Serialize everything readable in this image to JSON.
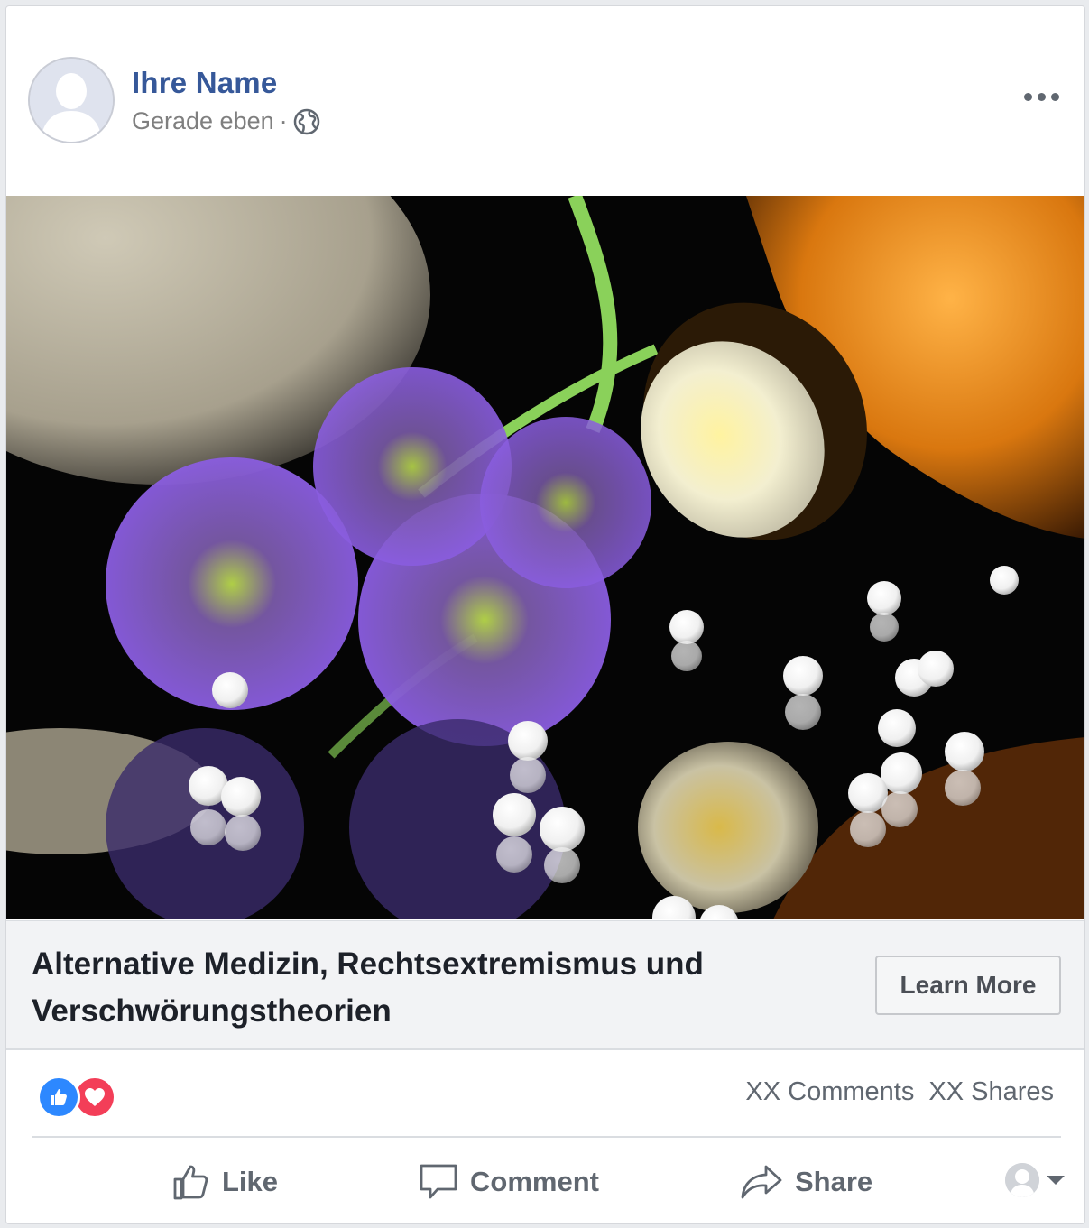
{
  "post": {
    "author_name": "Ihre Name",
    "timestamp": "Gerade eben",
    "separator": "·",
    "privacy_icon": "globe-icon",
    "more_icon": "more-options-icon"
  },
  "link_preview": {
    "headline": "Alternative Medizin, Rechtsextremismus und Verschwörungstheorien",
    "cta_label": "Learn More"
  },
  "engagement": {
    "reactions": [
      "like-reaction-icon",
      "love-reaction-icon"
    ],
    "comments": "XX Comments",
    "shares": "XX Shares"
  },
  "actions": {
    "like": "Like",
    "comment": "Comment",
    "share": "Share"
  },
  "colors": {
    "name_blue": "#365899",
    "like_blue": "#2d88ff",
    "love_red": "#f33e58",
    "text_gray": "#606770"
  }
}
